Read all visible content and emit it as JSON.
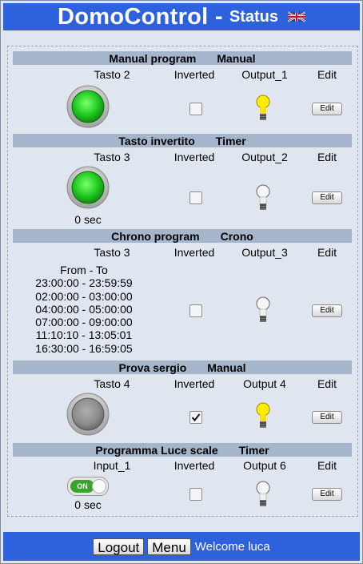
{
  "header": {
    "title": "DomoControl -",
    "subtitle": "Status",
    "flag_icon": "uk-flag-icon"
  },
  "columns": {
    "inverted": "Inverted",
    "edit": "Edit"
  },
  "edit_button": "Edit",
  "programs": [
    {
      "name": "Manual program",
      "mode": "Manual",
      "input": "Tasto 2",
      "output": "Output_1",
      "inverted": false,
      "input_state": "on",
      "output_on": true
    },
    {
      "name": "Tasto invertito",
      "mode": "Timer",
      "input": "Tasto 3",
      "output": "Output_2",
      "inverted": false,
      "input_state": "on",
      "output_on": false,
      "timer": "0 sec"
    },
    {
      "name": "Chrono program",
      "mode": "Crono",
      "input": "Tasto 3",
      "output": "Output_3",
      "inverted": false,
      "output_on": false,
      "schedule_header": "From - To",
      "schedule": [
        "23:00:00 - 23:59:59",
        "02:00:00 - 03:00:00",
        "04:00:00 - 05:00:00",
        "07:00:00 - 09:00:00",
        "11:10:10 - 13:05:01",
        "16:30:00 - 16:59:05"
      ]
    },
    {
      "name": "Prova sergio",
      "mode": "Manual",
      "input": "Tasto 4",
      "output": "Output 4",
      "inverted": true,
      "input_state": "off",
      "output_on": true
    },
    {
      "name": "Programma Luce scale",
      "mode": "Timer",
      "input": "Input_1",
      "output": "Output 6",
      "inverted": false,
      "output_on": false,
      "switch_label": "ON",
      "timer": "0 sec"
    }
  ],
  "footer": {
    "logout": "Logout",
    "menu": "Menu",
    "welcome": "Welcome luca"
  },
  "colors": {
    "header_bg": "#2e62dd",
    "section_bar": "#a5b6cc",
    "page_bg": "#dfe6f0",
    "knob_on": "#22cc22"
  }
}
